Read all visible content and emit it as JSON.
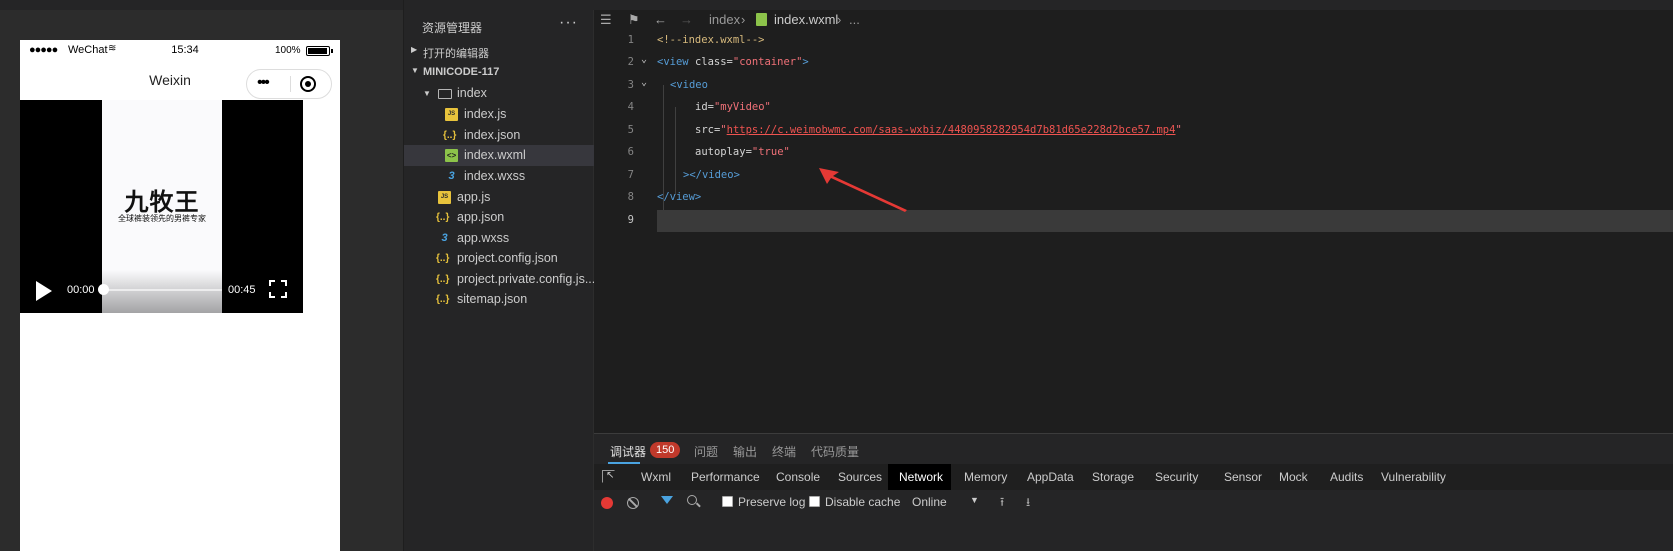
{
  "simulator": {
    "status": {
      "signal": "●●●●●",
      "carrier": "WeChat",
      "wifi": "≋",
      "time": "15:34",
      "battery": "100%"
    },
    "nav_title": "Weixin",
    "capsule_dots": "•••",
    "video": {
      "brand": "九牧王",
      "slogan": "全球裤装领先的男裤专家",
      "current_time": "00:00",
      "duration": "00:45",
      "progress": 0
    }
  },
  "explorer": {
    "title": "资源管理器",
    "more": "···",
    "sections": {
      "open_editors": "打开的编辑器",
      "project": "MINICODE-117"
    },
    "tree": [
      {
        "label": "index",
        "type": "folder"
      },
      {
        "label": "index.js",
        "type": "js"
      },
      {
        "label": "index.json",
        "type": "json"
      },
      {
        "label": "index.wxml",
        "type": "wxml",
        "selected": true
      },
      {
        "label": "index.wxss",
        "type": "wxss"
      },
      {
        "label": "app.js",
        "type": "js"
      },
      {
        "label": "app.json",
        "type": "json"
      },
      {
        "label": "app.wxss",
        "type": "wxss"
      },
      {
        "label": "project.config.json",
        "type": "json"
      },
      {
        "label": "project.private.config.js...",
        "type": "json"
      },
      {
        "label": "sitemap.json",
        "type": "json"
      }
    ],
    "icons": {
      "js": "JS",
      "json": "{..}",
      "wxml": "<>",
      "wxss": "3"
    }
  },
  "editor": {
    "breadcrumb": {
      "folder": "index",
      "file": "index.wxml",
      "tail": "..."
    },
    "lines": [
      {
        "n": "1",
        "comment": "<!--index.wxml-->"
      },
      {
        "n": "2",
        "open": "<view ",
        "attr": "class=",
        "val": "\"container\"",
        "close": ">"
      },
      {
        "n": "3",
        "tag": "<video"
      },
      {
        "n": "4",
        "attr": "id=",
        "val": "\"myVideo\""
      },
      {
        "n": "5",
        "attr": "src=",
        "q1": "\"",
        "link": "https://c.weimobwmc.com/saas-wxbiz/4480958282954d7b81d65e228d2bce57.mp4",
        "q2": "\""
      },
      {
        "n": "6",
        "attr": "autoplay=",
        "val": "\"true\""
      },
      {
        "n": "7",
        "tag": "></video>"
      },
      {
        "n": "8",
        "tag": "</view>"
      },
      {
        "n": "9"
      }
    ]
  },
  "devtools": {
    "tabs": [
      "调试器",
      "问题",
      "输出",
      "终端",
      "代码质量"
    ],
    "badge": "150",
    "panels": [
      "Wxml",
      "Performance",
      "Console",
      "Sources",
      "Network",
      "Memory",
      "AppData",
      "Storage",
      "Security",
      "Sensor",
      "Mock",
      "Audits",
      "Vulnerability"
    ],
    "active_panel": "Network",
    "network": {
      "preserve_log": "Preserve log",
      "disable_cache": "Disable cache",
      "throttle": "Online"
    }
  },
  "colors": {
    "accent": "#4aa3e0",
    "badge": "#c0392b",
    "record": "#e53935",
    "annotation_arrow": "#e53935"
  }
}
